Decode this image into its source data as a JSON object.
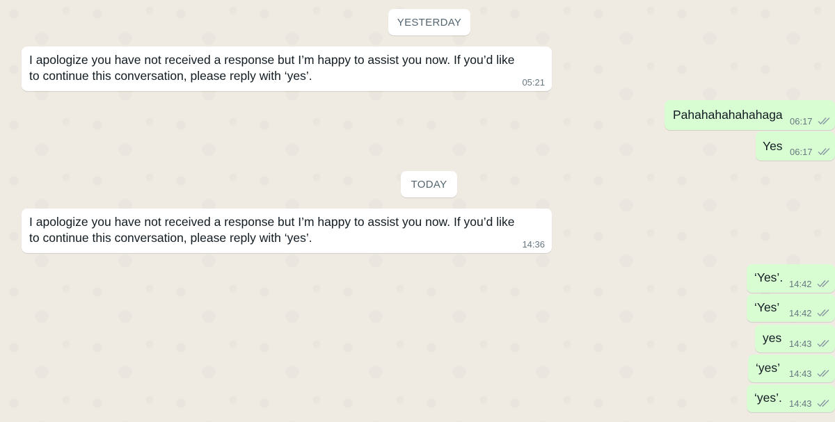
{
  "chat": {
    "date_separators": {
      "yesterday": "YESTERDAY",
      "today": "TODAY"
    },
    "messages": [
      {
        "direction": "incoming",
        "line1": "I apologize you have not received a response but I’m happy to assist you now. If you’d like",
        "line2": "to continue this conversation, please reply with ‘yes’.",
        "time": "05:21"
      },
      {
        "direction": "outgoing",
        "text": "Pahahahahahahaga",
        "time": "06:17",
        "status": "read"
      },
      {
        "direction": "outgoing",
        "text": "Yes",
        "time": "06:17",
        "status": "read"
      },
      {
        "direction": "incoming",
        "line1": "I apologize you have not received a response but I’m happy to assist you now. If you’d like",
        "line2": "to continue this conversation, please reply with ‘yes’.",
        "time": "14:36"
      },
      {
        "direction": "outgoing",
        "text": "‘Yes’.",
        "time": "14:42",
        "status": "read"
      },
      {
        "direction": "outgoing",
        "text": "‘Yes’",
        "time": "14:42",
        "status": "read"
      },
      {
        "direction": "outgoing",
        "text": "yes",
        "time": "14:43",
        "status": "read"
      },
      {
        "direction": "outgoing",
        "text": "‘yes’",
        "time": "14:43",
        "status": "read"
      },
      {
        "direction": "outgoing",
        "text": "‘yes’.",
        "time": "14:43",
        "status": "read"
      }
    ]
  },
  "icons": {
    "read_receipt": "double-check-icon"
  },
  "colors": {
    "background": "#efeae2",
    "incoming_bubble": "#ffffff",
    "outgoing_bubble": "#d9fdd3",
    "text": "#111b21",
    "meta_text": "#667781",
    "receipt": "#8696a0"
  }
}
